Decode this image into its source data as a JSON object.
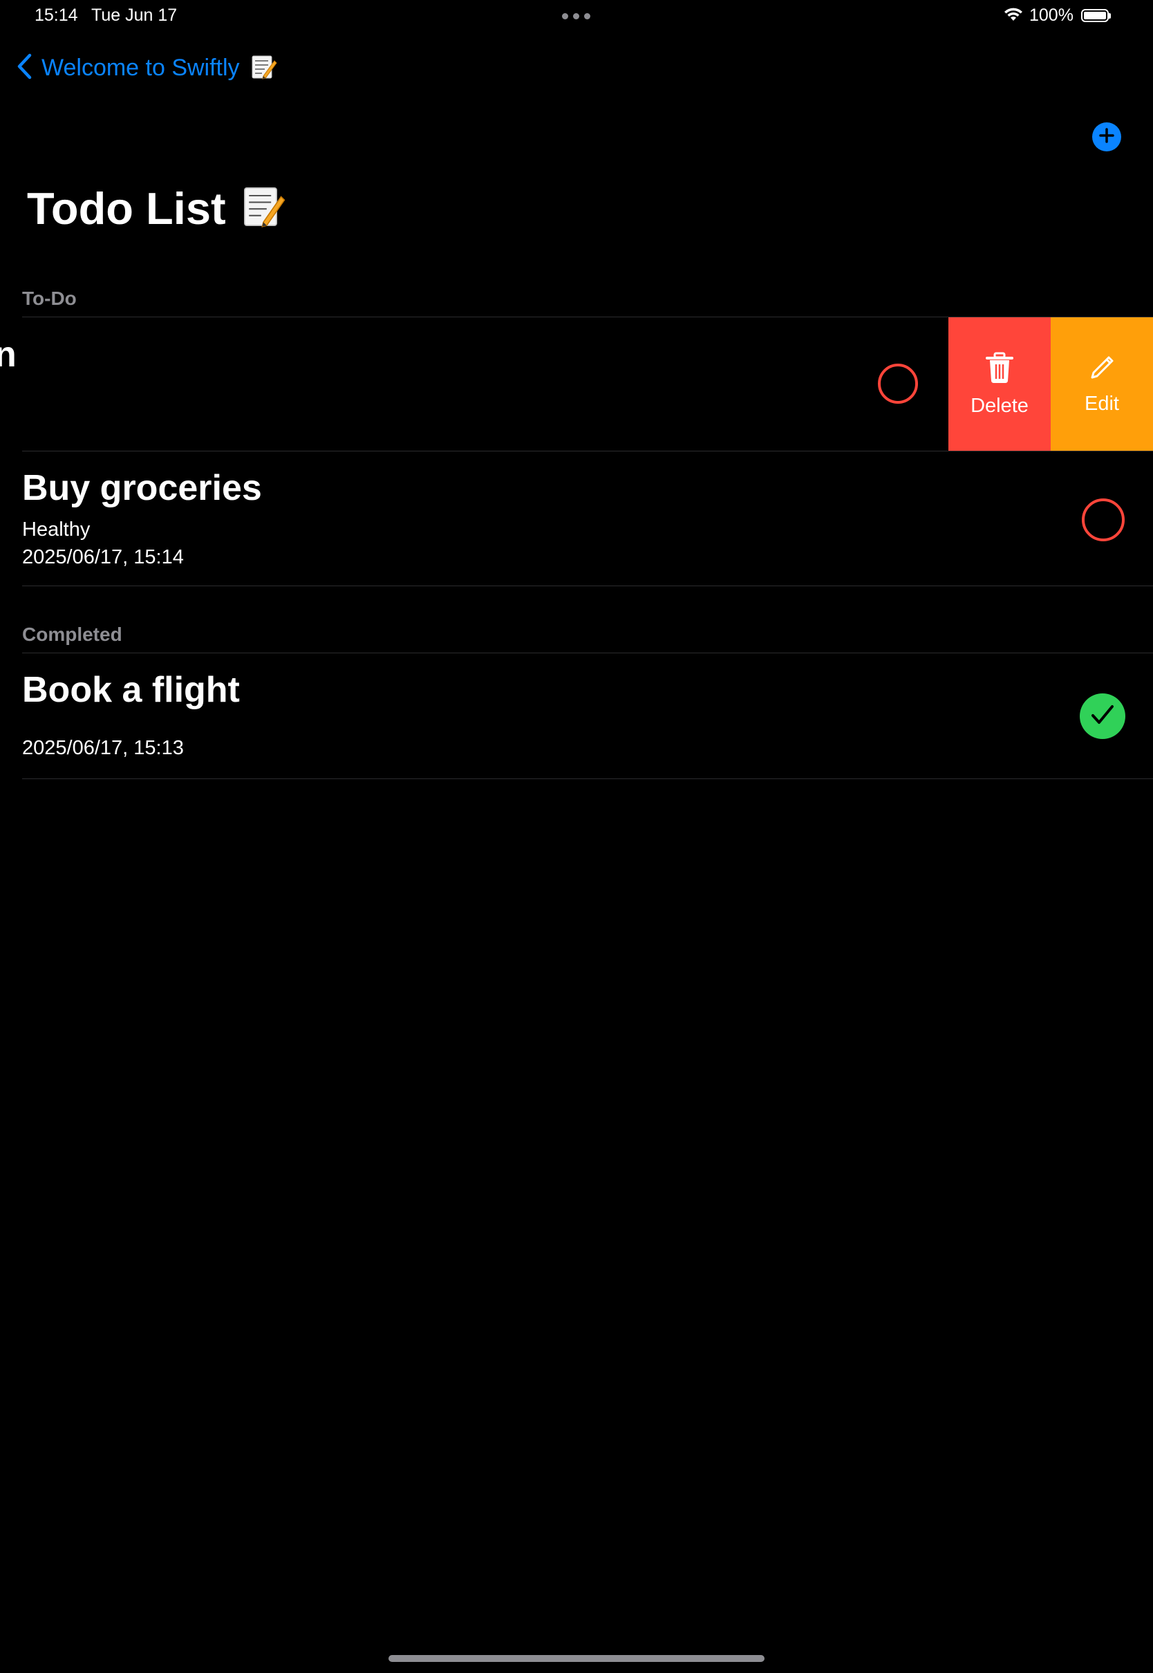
{
  "status_bar": {
    "time": "15:14",
    "date": "Tue Jun 17",
    "battery_percent": "100%",
    "battery_level": 1.0,
    "icons": [
      "wifi-icon",
      "battery-icon"
    ]
  },
  "nav": {
    "back_label": "Welcome to Swiftly",
    "back_icon": "chevron-left-icon",
    "add_icon": "plus-circle-icon",
    "accent_color": "#0a84ff"
  },
  "page": {
    "title": "Todo List",
    "title_icon": "memo-icon"
  },
  "sections": {
    "todo_header": "To-Do",
    "completed_header": "Completed"
  },
  "swiped_row": {
    "visible_title_fragment": "n",
    "actions": [
      {
        "label": "Delete",
        "icon": "trash-icon",
        "color": "#ff453a"
      },
      {
        "label": "Edit",
        "icon": "pencil-icon",
        "color": "#ff9f0a"
      }
    ]
  },
  "todo_items": [
    {
      "title": "Buy groceries",
      "note": "Healthy",
      "date": "2025/06/17, 15:14",
      "done": false
    }
  ],
  "completed_items": [
    {
      "title": "Book a flight",
      "note": "",
      "date": "2025/06/17, 15:13",
      "done": true
    }
  ],
  "colors": {
    "incomplete_ring": "#ff453a",
    "complete_fill": "#30d158",
    "secondary_text": "#8e8e93"
  }
}
